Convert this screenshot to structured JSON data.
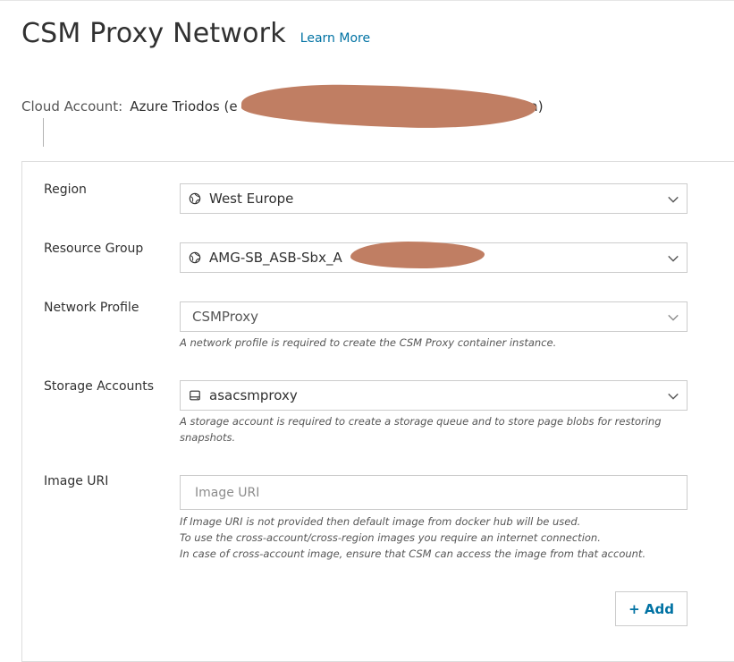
{
  "header": {
    "title": "CSM Proxy Network",
    "learn_more": "Learn More"
  },
  "account": {
    "label": "Cloud Account:",
    "value": "Azure Triodos (e",
    "value_suffix": "a)"
  },
  "form": {
    "region": {
      "label": "Region",
      "value": "West Europe",
      "icon": "globe-icon"
    },
    "resource_group": {
      "label": "Resource Group",
      "value": "AMG-SB_ASB-Sbx_A",
      "icon": "globe-icon"
    },
    "network_profile": {
      "label": "Network Profile",
      "value": "CSMProxy",
      "help": "A network profile is required to create the CSM Proxy container instance."
    },
    "storage_accounts": {
      "label": "Storage Accounts",
      "value": "asacsmproxy",
      "icon": "storage-icon",
      "help": "A storage account is required to create a storage queue and to store page blobs for restoring snapshots."
    },
    "image_uri": {
      "label": "Image URI",
      "placeholder": "Image URI",
      "value": "",
      "help": [
        "If Image URI is not provided then default image from docker hub will be used.",
        "To use the cross-account/cross-region images you require an internet connection.",
        "In case of cross-account image, ensure that CSM can access the image from that account."
      ]
    },
    "add_button": "+ Add"
  },
  "colors": {
    "link": "#0072a3",
    "border": "#cccccc",
    "text": "#313131",
    "redaction": "#c07e63"
  }
}
